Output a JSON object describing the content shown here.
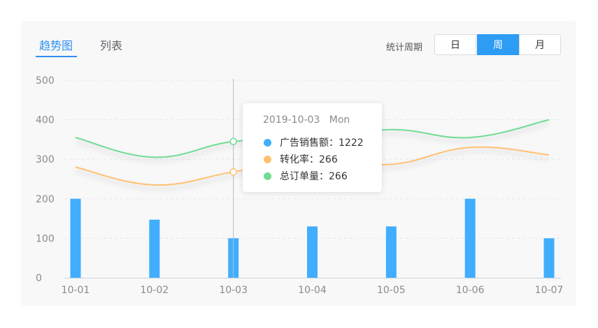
{
  "tabs": [
    {
      "label": "趋势图",
      "active": true
    },
    {
      "label": "列表",
      "active": false
    }
  ],
  "period": {
    "label": "统计周期",
    "options": [
      {
        "label": "日",
        "active": false
      },
      {
        "label": "周",
        "active": true
      },
      {
        "label": "月",
        "active": false
      }
    ]
  },
  "colors": {
    "bar": "#40aefc",
    "line_orange": "#fec171",
    "line_green": "#6fdc92",
    "accent": "#2f8ff0"
  },
  "chart_data": {
    "type": "bar+line",
    "categories": [
      "10-01",
      "10-02",
      "10-03",
      "10-04",
      "10-05",
      "10-06",
      "10-07"
    ],
    "y_ticks": [
      "0",
      "100",
      "200",
      "300",
      "400",
      "500"
    ],
    "ylim": [
      0,
      500
    ],
    "grid": true,
    "bars": [
      200,
      147,
      100,
      130,
      130,
      200,
      100
    ],
    "lines": [
      {
        "color": "green",
        "values": [
          355,
          305,
          345,
          350,
          375,
          355,
          400
        ]
      },
      {
        "color": "orange",
        "values": [
          280,
          235,
          268,
          300,
          287,
          330,
          311
        ]
      }
    ],
    "highlight_index": 2
  },
  "tooltip": {
    "date": "2019-10-03",
    "weekday": "Mon",
    "rows": [
      {
        "label": "广告销售额：1222",
        "color": "#40aefc"
      },
      {
        "label": "转化率：266",
        "color": "#fec171"
      },
      {
        "label": "总订单量：266",
        "color": "#6fdc92"
      }
    ]
  }
}
